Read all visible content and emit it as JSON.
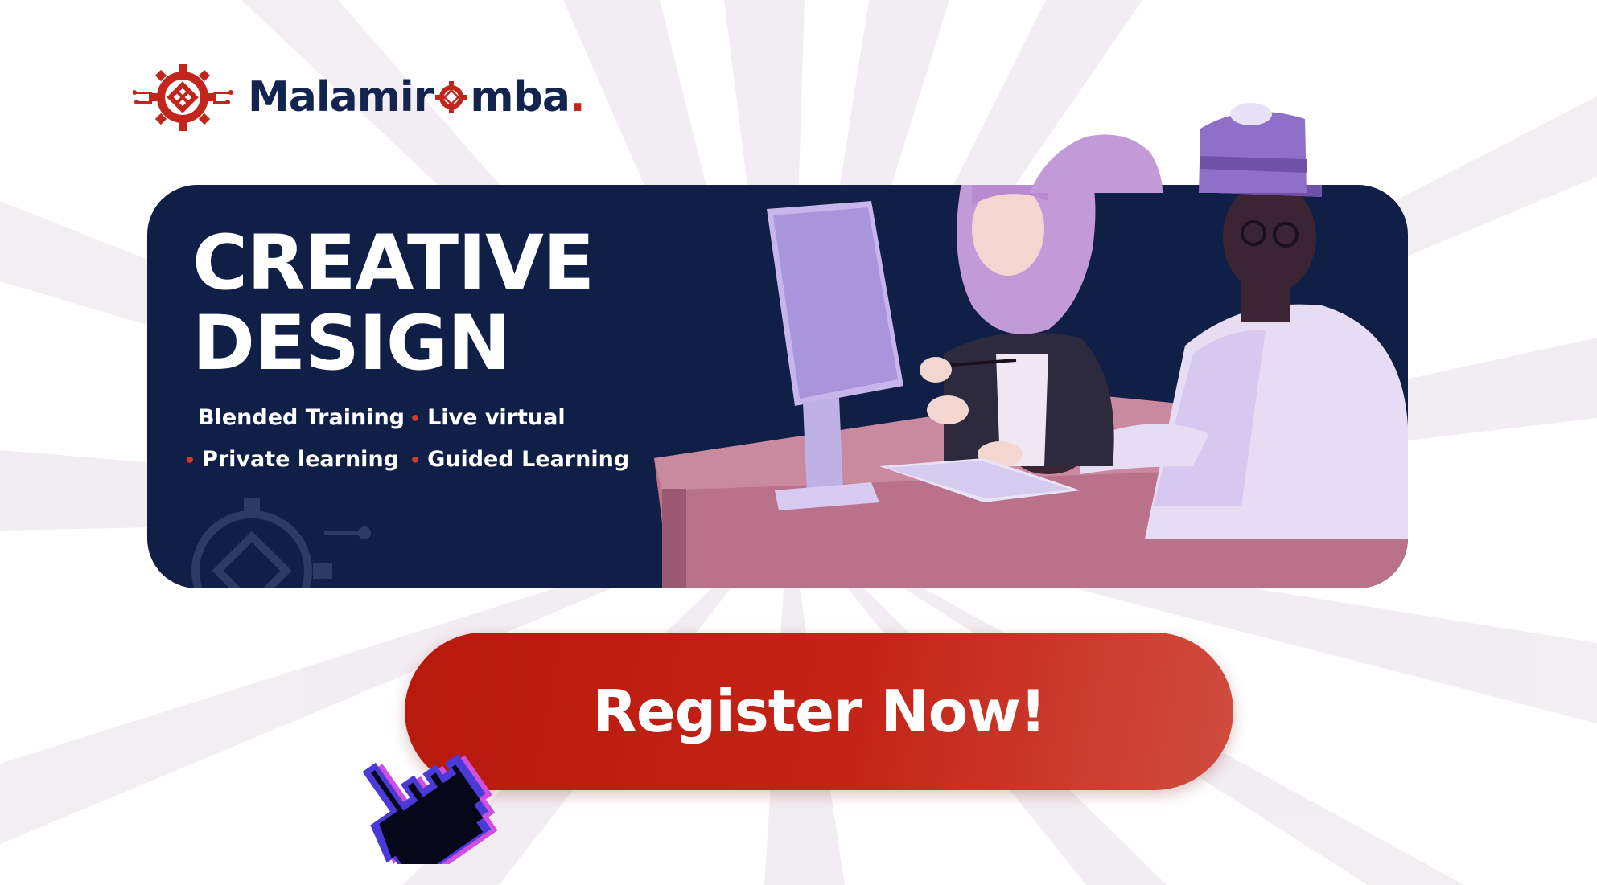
{
  "brand": {
    "name_part1": "Malamir",
    "name_part2": "mba",
    "name_dot": ".",
    "logo_icon": "gear-knot-logo-icon",
    "color_primary": "#13244f",
    "color_accent": "#c1251b"
  },
  "banner": {
    "title_line1": "CREATIVE",
    "title_line2": "DESIGN",
    "features": [
      "Blended Training",
      "Live virtual",
      "Private learning",
      "Guided Learning"
    ],
    "bullet": "•",
    "background_color": "#101f45",
    "illustration": "two-people-at-computer-illustration"
  },
  "cta": {
    "label": "Register Now!",
    "color": "#c42417",
    "cursor_icon": "pointing-hand-cursor-icon"
  }
}
